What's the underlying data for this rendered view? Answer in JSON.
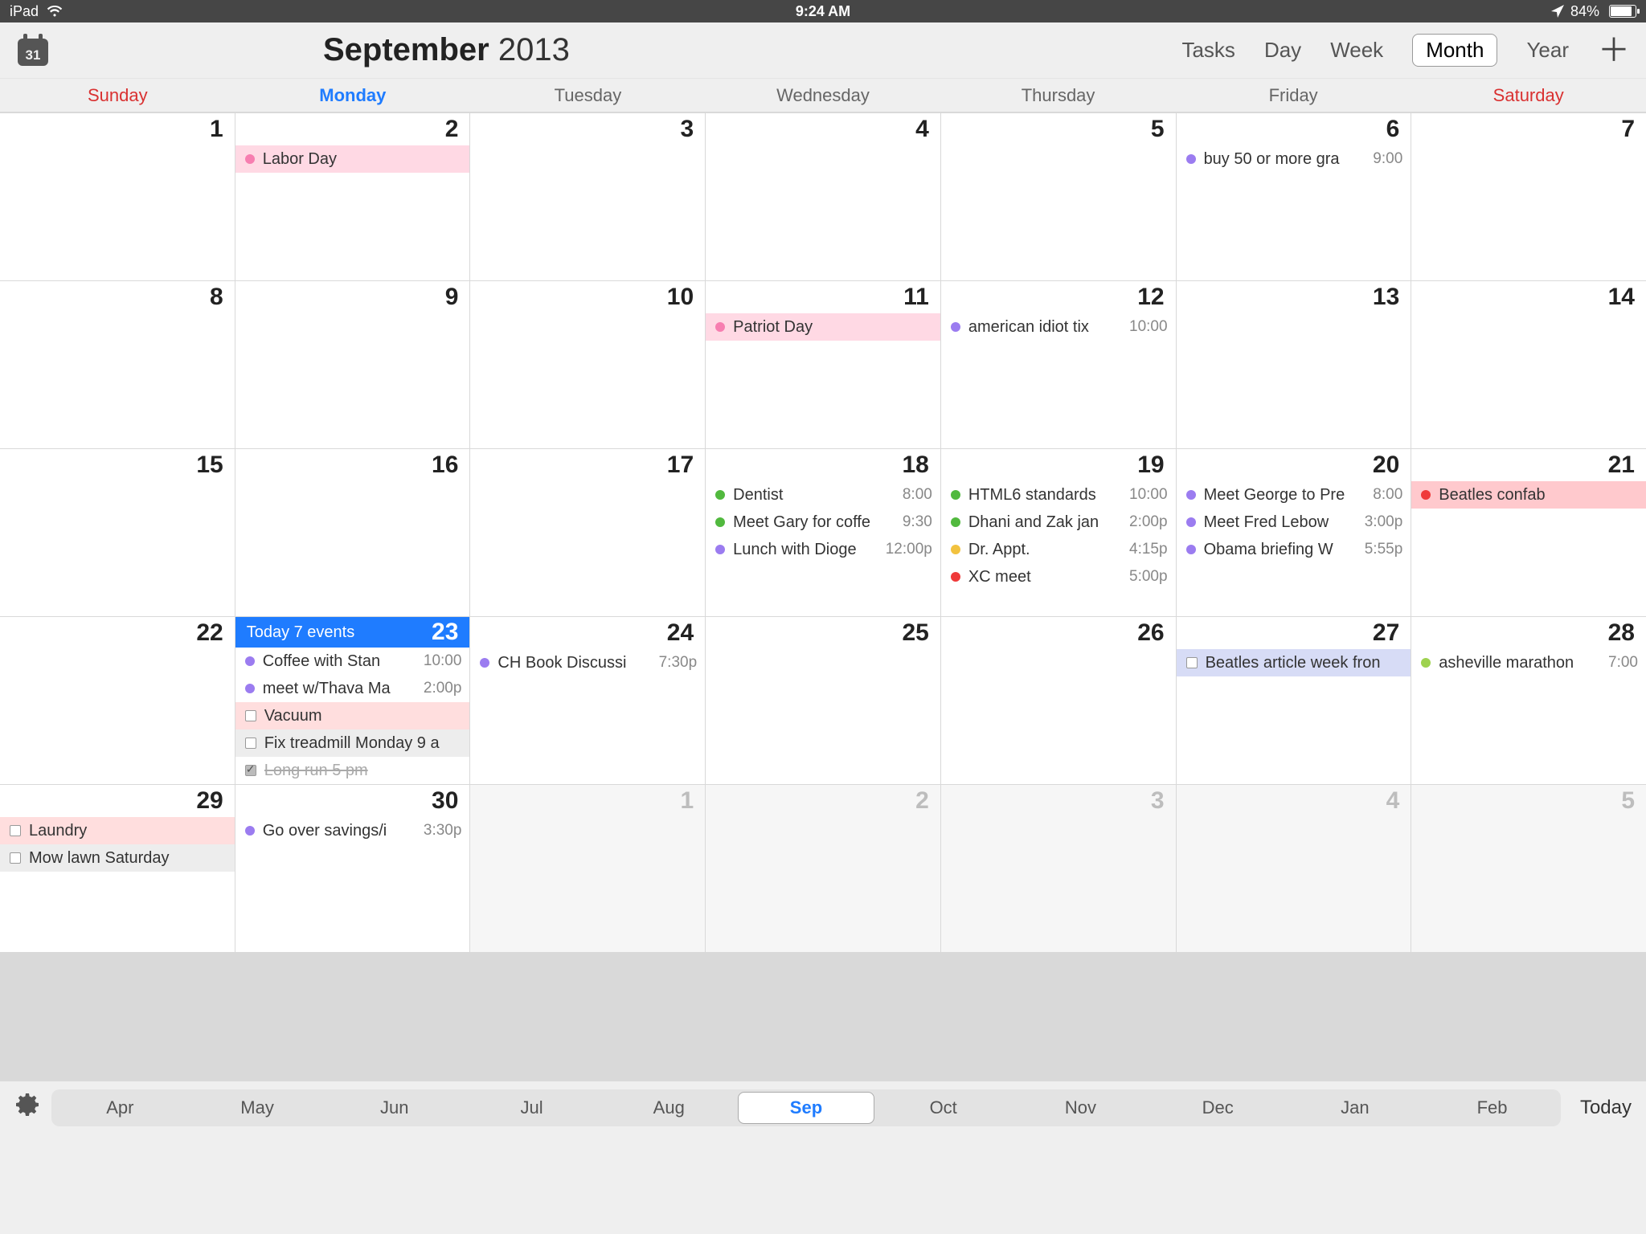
{
  "status": {
    "device": "iPad",
    "time": "9:24 AM",
    "battery": "84%"
  },
  "header": {
    "month": "September",
    "year": "2013",
    "views": [
      "Tasks",
      "Day",
      "Week",
      "Month",
      "Year"
    ],
    "active_view": "Month"
  },
  "dow": [
    "Sunday",
    "Monday",
    "Tuesday",
    "Wednesday",
    "Thursday",
    "Friday",
    "Saturday"
  ],
  "today_label": "Today 7 events",
  "cells": [
    {
      "n": "1"
    },
    {
      "n": "2",
      "events": [
        {
          "kind": "fill-pink",
          "dot": "c-pink",
          "txt": "Labor Day"
        }
      ]
    },
    {
      "n": "3"
    },
    {
      "n": "4"
    },
    {
      "n": "5"
    },
    {
      "n": "6",
      "events": [
        {
          "dot": "c-purple",
          "txt": "buy 50 or more gra",
          "time": "9:00"
        }
      ]
    },
    {
      "n": "7"
    },
    {
      "n": "8"
    },
    {
      "n": "9"
    },
    {
      "n": "10"
    },
    {
      "n": "11",
      "events": [
        {
          "kind": "fill-pink",
          "dot": "c-pink",
          "txt": "Patriot Day"
        }
      ]
    },
    {
      "n": "12",
      "events": [
        {
          "dot": "c-purple",
          "txt": "american idiot tix",
          "time": "10:00"
        }
      ]
    },
    {
      "n": "13"
    },
    {
      "n": "14"
    },
    {
      "n": "15"
    },
    {
      "n": "16"
    },
    {
      "n": "17"
    },
    {
      "n": "18",
      "events": [
        {
          "dot": "c-green",
          "txt": "Dentist",
          "time": "8:00"
        },
        {
          "dot": "c-green",
          "txt": "Meet Gary for coffe",
          "time": "9:30"
        },
        {
          "dot": "c-purple",
          "txt": "Lunch with Dioge",
          "time": "12:00p"
        }
      ]
    },
    {
      "n": "19",
      "events": [
        {
          "dot": "c-green",
          "txt": "HTML6 standards",
          "time": "10:00"
        },
        {
          "dot": "c-green",
          "txt": "Dhani and Zak jan",
          "time": "2:00p"
        },
        {
          "dot": "c-yellow",
          "txt": "Dr. Appt.",
          "time": "4:15p"
        },
        {
          "dot": "c-red",
          "txt": "XC meet",
          "time": "5:00p"
        }
      ]
    },
    {
      "n": "20",
      "events": [
        {
          "dot": "c-purple",
          "txt": "Meet George to Pre",
          "time": "8:00"
        },
        {
          "dot": "c-purple",
          "txt": "Meet Fred Lebow",
          "time": "3:00p"
        },
        {
          "dot": "c-purple",
          "txt": "Obama briefing W",
          "time": "5:55p"
        }
      ]
    },
    {
      "n": "21",
      "events": [
        {
          "kind": "fill-red",
          "dot": "c-red",
          "txt": "Beatles confab"
        }
      ]
    },
    {
      "n": "22"
    },
    {
      "n": "23",
      "today": true,
      "events": [
        {
          "dot": "c-purple",
          "txt": "Coffee with Stan",
          "time": "10:00"
        },
        {
          "dot": "c-purple",
          "txt": "meet w/Thava Ma",
          "time": "2:00p"
        },
        {
          "kind": "fill-rose",
          "box": true,
          "txt": "Vacuum"
        },
        {
          "kind": "fill-grey",
          "box": true,
          "txt": "Fix treadmill Monday 9 a"
        },
        {
          "kind": "done",
          "box": true,
          "checked": true,
          "txt": "Long run 5 pm"
        }
      ]
    },
    {
      "n": "24",
      "events": [
        {
          "dot": "c-purple",
          "txt": "CH Book Discussi",
          "time": "7:30p"
        }
      ]
    },
    {
      "n": "25"
    },
    {
      "n": "26"
    },
    {
      "n": "27",
      "events": [
        {
          "kind": "fill-lav",
          "box": true,
          "txt": "Beatles article week fron"
        }
      ]
    },
    {
      "n": "28",
      "events": [
        {
          "dot": "c-lime",
          "txt": "asheville marathon",
          "time": "7:00"
        }
      ]
    },
    {
      "n": "29",
      "events": [
        {
          "kind": "fill-rose",
          "box": true,
          "txt": "Laundry"
        },
        {
          "kind": "fill-grey",
          "box": true,
          "txt": "Mow lawn Saturday"
        }
      ]
    },
    {
      "n": "30",
      "events": [
        {
          "dot": "c-purple",
          "txt": "Go over savings/i",
          "time": "3:30p"
        }
      ]
    },
    {
      "n": "1",
      "out": true
    },
    {
      "n": "2",
      "out": true
    },
    {
      "n": "3",
      "out": true
    },
    {
      "n": "4",
      "out": true
    },
    {
      "n": "5",
      "out": true
    }
  ],
  "months": [
    "Apr",
    "May",
    "Jun",
    "Jul",
    "Aug",
    "Sep",
    "Oct",
    "Nov",
    "Dec",
    "Jan",
    "Feb"
  ],
  "active_month": "Sep",
  "today_link": "Today"
}
